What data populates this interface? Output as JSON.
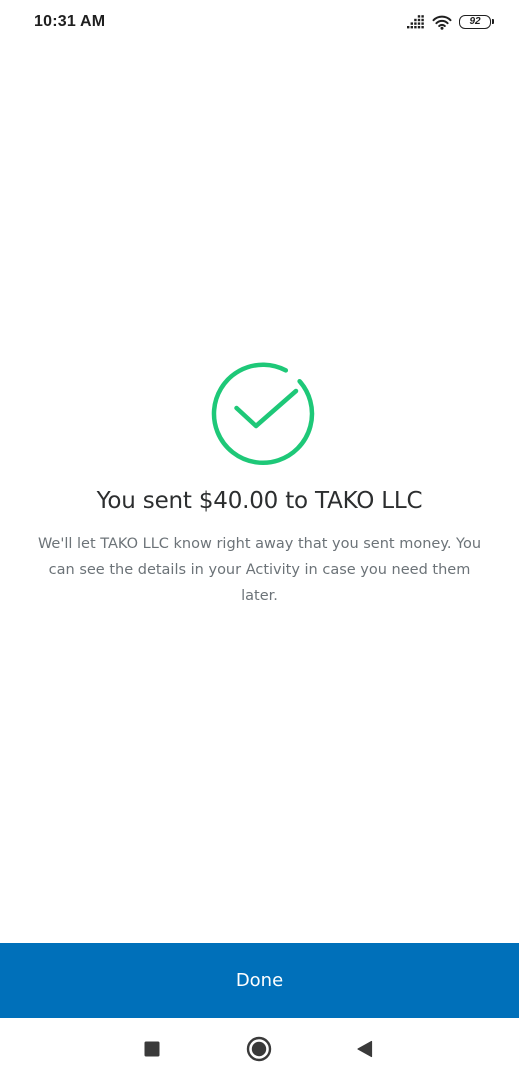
{
  "status_bar": {
    "time": "10:31 AM",
    "battery_level": "92",
    "icons": [
      "signal-icon",
      "wifi-icon",
      "battery-icon"
    ]
  },
  "success": {
    "icon": "checkmark-circle-icon",
    "title": "You sent $40.00 to TAKO LLC",
    "message": "We'll let TAKO LLC know right away that you sent money. You can see the details in your Activity in case you need them later."
  },
  "done_button": {
    "label": "Done"
  },
  "nav_bar": {
    "icons": [
      "recents-square-icon",
      "home-circle-icon",
      "back-triangle-icon"
    ]
  },
  "colors": {
    "accent": "#0070ba",
    "success_green": "#1ec878",
    "title_text": "#2c2e2f",
    "body_text": "#6c7378",
    "background": "#ffffff"
  }
}
